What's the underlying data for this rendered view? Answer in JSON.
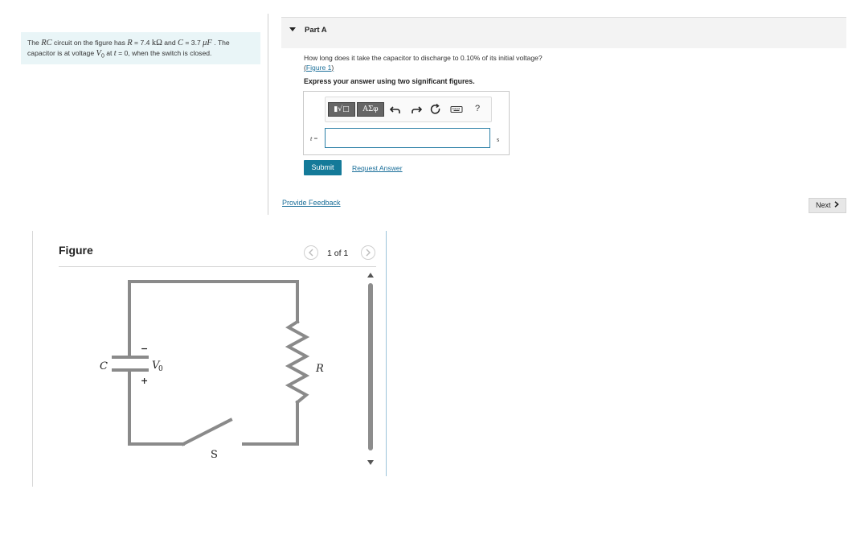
{
  "problem": {
    "t1": "The ",
    "rc": "RC",
    "t2": " circuit on the figure has ",
    "R": "R",
    "t3": " = 7.4 ",
    "kohm": "kΩ",
    "t4": " and ",
    "C": "C",
    "t5": " = 3.7 ",
    "uf": "μF",
    "t6": " . The",
    "t7": "capacitor is at voltage ",
    "V": "V",
    "vsub": "0",
    "t8": " at ",
    "t": "t",
    "t9": " = 0, when the switch is closed."
  },
  "part": {
    "title": "Part A"
  },
  "question": {
    "text": "How long does it take the capacitor to discharge to 0.10% of its initial voltage?",
    "paren_open": "(",
    "figure_link": "Figure 1",
    "paren_close": ")"
  },
  "instruction": "Express your answer using two significant figures.",
  "answer": {
    "var": "t",
    "eq": " =",
    "value": "",
    "unit": "s",
    "tool_templates": "▮√□",
    "tool_greek": "ΑΣφ",
    "help": "?"
  },
  "buttons": {
    "submit": "Submit",
    "request": "Request Answer",
    "feedback": "Provide Feedback",
    "next": "Next"
  },
  "figure": {
    "title": "Figure",
    "pager": "1 of 1",
    "label_C": "C",
    "label_minus": "−",
    "label_plus": "+",
    "label_V": "V",
    "label_V_sub": "0",
    "label_R": "R",
    "label_S": "S"
  },
  "colors": {
    "accent": "#147a99",
    "link": "#1a6e99",
    "wire": "#8a8a8a"
  }
}
